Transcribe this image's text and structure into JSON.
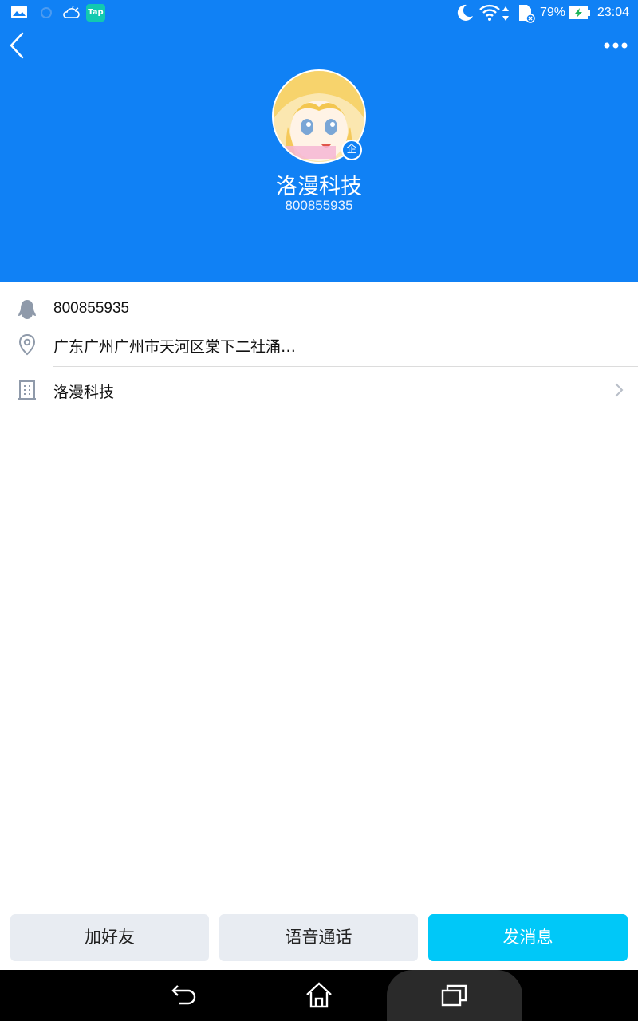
{
  "status_bar": {
    "battery": "79%",
    "time": "23:04",
    "tap_label": "Tap"
  },
  "profile": {
    "name": "洛漫科技",
    "uid": "800855935",
    "badge": "企"
  },
  "info": {
    "qq_number": "800855935",
    "location": "广东广州广州市天河区棠下二社涌…",
    "company": "洛漫科技"
  },
  "actions": {
    "add_friend": "加好友",
    "voice_call": "语音通话",
    "send_message": "发消息"
  },
  "colors": {
    "header_bg": "#1081f5",
    "primary_button": "#00c8f8",
    "secondary_button": "#e8ecf2"
  }
}
